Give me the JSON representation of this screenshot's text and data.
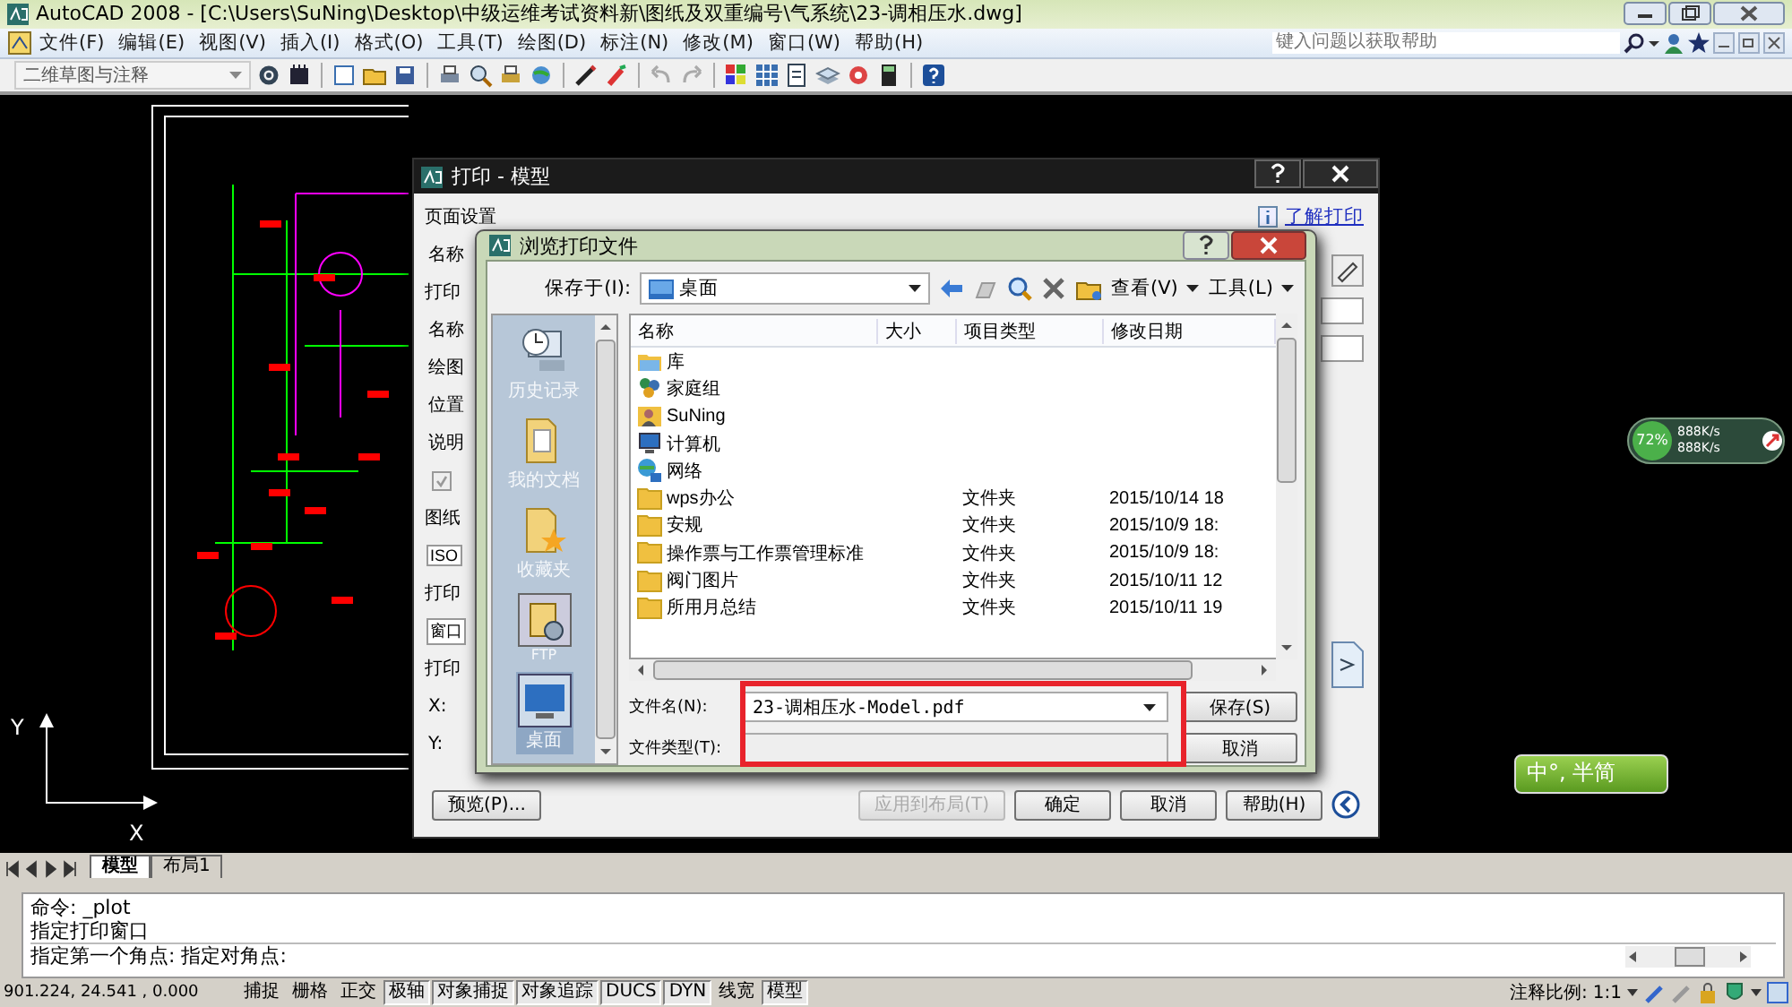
{
  "app": {
    "title": "AutoCAD 2008 - [C:\\Users\\SuNing\\Desktop\\中级运维考试资料新\\图纸及双重编号\\气系统\\23-调相压水.dwg]"
  },
  "menu": [
    "文件(F)",
    "编辑(E)",
    "视图(V)",
    "插入(I)",
    "格式(O)",
    "工具(T)",
    "绘图(D)",
    "标注(N)",
    "修改(M)",
    "窗口(W)",
    "帮助(H)"
  ],
  "help_search": {
    "placeholder": "键入问题以获取帮助"
  },
  "toolbar": {
    "workspace": "二维草图与注释"
  },
  "canvas": {
    "axis_x": "X",
    "axis_y": "Y"
  },
  "print_dialog": {
    "title": "打印 - 模型",
    "link": "了解打印",
    "items": [
      {
        "kind": "heading",
        "text": "页面设置"
      },
      {
        "kind": "label",
        "text": "名称"
      },
      {
        "kind": "heading",
        "text": "打印"
      },
      {
        "kind": "label",
        "text": "名称"
      },
      {
        "kind": "label",
        "text": "绘图"
      },
      {
        "kind": "label",
        "text": "位置"
      },
      {
        "kind": "label",
        "text": "说明"
      },
      {
        "kind": "checkbox",
        "checked": true,
        "disabled": true
      },
      {
        "kind": "heading",
        "text": "图纸"
      },
      {
        "kind": "select",
        "text": "ISO"
      },
      {
        "kind": "heading",
        "text": "打印"
      },
      {
        "kind": "select",
        "text": "窗口"
      },
      {
        "kind": "heading",
        "text": "打印"
      },
      {
        "kind": "label",
        "text": "X:"
      },
      {
        "kind": "label",
        "text": "Y:"
      }
    ],
    "buttons": [
      {
        "label": "预览(P)...",
        "disabled": false
      },
      {
        "label": "应用到布局(T)",
        "disabled": true
      },
      {
        "label": "确定",
        "disabled": false
      },
      {
        "label": "取消",
        "disabled": false
      },
      {
        "label": "帮助(H)",
        "disabled": false
      }
    ]
  },
  "browse_dialog": {
    "title": "浏览打印文件",
    "save_in_label": "保存于(I):",
    "save_in": "桌面",
    "view_menu": "查看(V)",
    "tools_menu": "工具(L)",
    "places": [
      {
        "label": "历史记录",
        "selected": false,
        "kind": "history"
      },
      {
        "label": "我的文档",
        "selected": false,
        "kind": "documents"
      },
      {
        "label": "收藏夹",
        "selected": false,
        "kind": "favorites"
      },
      {
        "label": "FTP",
        "selected": false,
        "kind": "ftp"
      },
      {
        "label": "桌面",
        "selected": true,
        "kind": "desktop"
      }
    ],
    "columns": [
      "名称",
      "大小",
      "项目类型",
      "修改日期"
    ],
    "rows": [
      {
        "kind": "library",
        "name": "库"
      },
      {
        "kind": "homegroup",
        "name": "家庭组"
      },
      {
        "kind": "user",
        "name": "SuNing"
      },
      {
        "kind": "computer",
        "name": "计算机"
      },
      {
        "kind": "network",
        "name": "网络"
      },
      {
        "kind": "folder",
        "name": "wps办公",
        "type": "文件夹",
        "date": "2015/10/14 18"
      },
      {
        "kind": "folder",
        "name": "安规",
        "type": "文件夹",
        "date": "2015/10/9 18:"
      },
      {
        "kind": "folder",
        "name": "操作票与工作票管理标准",
        "type": "文件夹",
        "date": "2015/10/9 18:"
      },
      {
        "kind": "folder",
        "name": "阀门图片",
        "type": "文件夹",
        "date": "2015/10/11 12"
      },
      {
        "kind": "folder",
        "name": "所用月总结",
        "type": "文件夹",
        "date": "2015/10/11 19"
      }
    ],
    "file_name_label": "文件名(N):",
    "file_name": "23-调相压水-Model.pdf",
    "file_type_label": "文件类型(T):",
    "buttons": [
      "保存(S)",
      "取消"
    ]
  },
  "layout_tabs": [
    {
      "label": "模型",
      "selected": true
    },
    {
      "label": "布局1",
      "selected": false
    }
  ],
  "command_lines": [
    "命令:  _plot",
    "指定打印窗口"
  ],
  "command_prompt": "指定第一个角点: 指定对角点:",
  "status_bar": {
    "coordinates": "901.224, 24.541 , 0.000",
    "toggles": [
      {
        "label": "捕捉",
        "on": false
      },
      {
        "label": "栅格",
        "on": false
      },
      {
        "label": "正交",
        "on": false
      },
      {
        "label": "极轴",
        "on": true
      },
      {
        "label": "对象捕捉",
        "on": true
      },
      {
        "label": "对象追踪",
        "on": true
      },
      {
        "label": "DUCS",
        "on": true
      },
      {
        "label": "DYN",
        "on": true
      },
      {
        "label": "线宽",
        "on": false
      },
      {
        "label": "模型",
        "on": true
      }
    ],
    "scale_label": "注释比例:",
    "scale": "1:1"
  },
  "widgets": {
    "network_percent": "72%",
    "upload": "888K/s",
    "download": "888K/s",
    "ime": "中°, 半简"
  }
}
